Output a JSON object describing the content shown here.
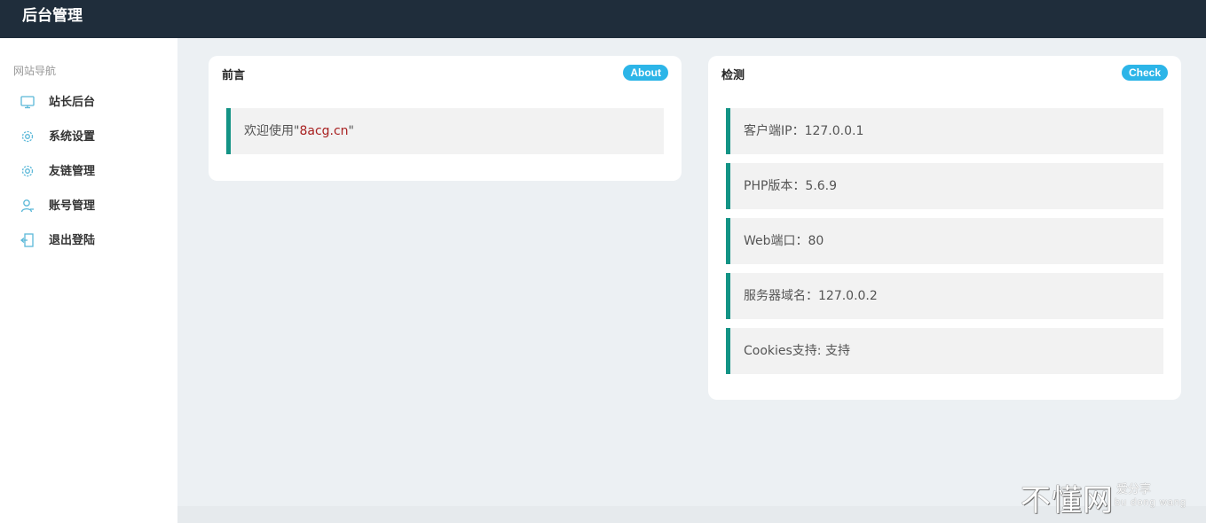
{
  "header": {
    "title": "后台管理"
  },
  "sidebar": {
    "section_title": "网站导航",
    "items": [
      {
        "label": "站长后台",
        "icon": "monitor-icon"
      },
      {
        "label": "系统设置",
        "icon": "gear-icon"
      },
      {
        "label": "友链管理",
        "icon": "gear-icon"
      },
      {
        "label": "账号管理",
        "icon": "user-icon"
      },
      {
        "label": "退出登陆",
        "icon": "logout-icon"
      }
    ]
  },
  "cards": {
    "about": {
      "title": "前言",
      "badge": "About",
      "text_prefix": "欢迎使用\"",
      "text_highlight": "8acg.cn",
      "text_suffix": "\""
    },
    "check": {
      "title": "检测",
      "badge": "Check",
      "items": [
        "客户端IP：127.0.0.1",
        "PHP版本：5.6.9",
        "Web端口：80",
        "服务器域名：127.0.0.2",
        "Cookies支持: 支持"
      ]
    }
  },
  "watermark": {
    "main": "不懂网",
    "line1": "爱分享",
    "line2": "bu dong wang"
  },
  "colors": {
    "topbar": "#1f2d3b",
    "accent_border": "#139385",
    "badge": "#2cb5e8",
    "icon": "#5bb8d8",
    "highlight_text": "#a82020"
  }
}
